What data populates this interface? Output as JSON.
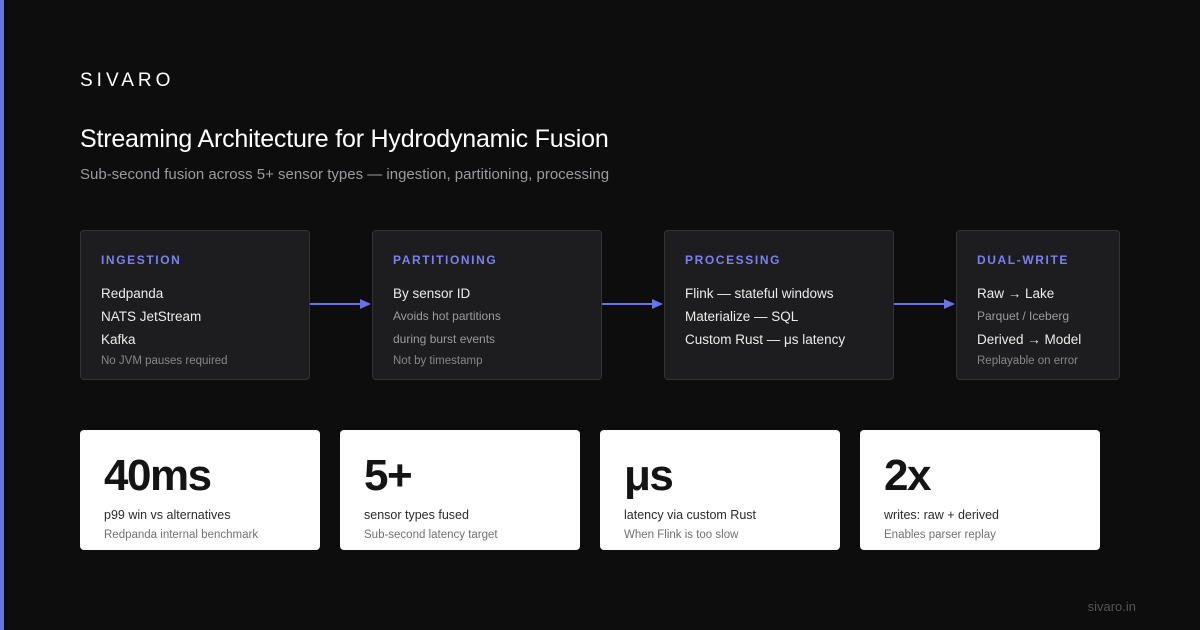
{
  "brand": "SIVARO",
  "title": "Streaming Architecture for Hydrodynamic Fusion",
  "subtitle": "Sub-second fusion across 5+ sensor types — ingestion, partitioning, processing",
  "colors": {
    "background": "#0d0d0d",
    "accent": "#6b72e8",
    "card": "#1d1d1f",
    "metric_card": "#ffffff"
  },
  "stages": [
    {
      "label": "INGESTION",
      "lines": [
        {
          "text": "Redpanda",
          "style": "main"
        },
        {
          "text": "NATS JetStream",
          "style": "main"
        },
        {
          "text": "Kafka",
          "style": "main"
        }
      ],
      "footnote": "No JVM pauses required"
    },
    {
      "label": "PARTITIONING",
      "lines": [
        {
          "text": "By sensor ID",
          "style": "main"
        },
        {
          "text": "Avoids hot partitions",
          "style": "sub"
        },
        {
          "text": "during burst events",
          "style": "sub"
        }
      ],
      "footnote": "Not by timestamp"
    },
    {
      "label": "PROCESSING",
      "lines": [
        {
          "text": "Flink — stateful windows",
          "style": "main"
        },
        {
          "text": "Materialize — SQL",
          "style": "main"
        },
        {
          "text": "Custom Rust — μs latency",
          "style": "main"
        }
      ],
      "footnote": ""
    },
    {
      "label": "DUAL-WRITE",
      "lines": [
        {
          "text": "Raw → Lake",
          "style": "main"
        },
        {
          "text": "Parquet / Iceberg",
          "style": "sub"
        },
        {
          "text": "Derived → Model",
          "style": "main"
        }
      ],
      "footnote": "Replayable on error"
    }
  ],
  "metrics": [
    {
      "value": "40ms",
      "label": "p99 win vs alternatives",
      "note": "Redpanda internal benchmark"
    },
    {
      "value": "5+",
      "label": "sensor types fused",
      "note": "Sub-second latency target"
    },
    {
      "value": "μs",
      "label": "latency via custom Rust",
      "note": "When Flink is too slow"
    },
    {
      "value": "2x",
      "label": "writes: raw + derived",
      "note": "Enables parser replay"
    }
  ],
  "footer_url": "sivaro.in"
}
